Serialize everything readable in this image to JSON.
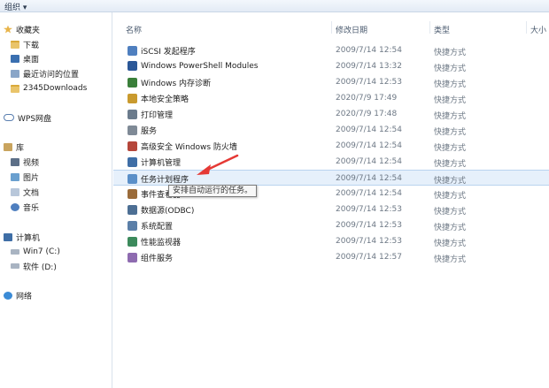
{
  "toolbar": {
    "organize": "组织 ▾"
  },
  "nav": {
    "favorites": "收藏夹",
    "favorite_items": [
      "下载",
      "桌面",
      "最近访问的位置",
      "2345Downloads"
    ],
    "wps": "WPS网盘",
    "library": "库",
    "library_items": [
      "视频",
      "图片",
      "文档",
      "音乐"
    ],
    "computer": "计算机",
    "drives": [
      "Win7 (C:)",
      "软件 (D:)"
    ],
    "network": "网络"
  },
  "columns": {
    "name": "名称",
    "date": "修改日期",
    "type": "类型",
    "size": "大小"
  },
  "files": [
    {
      "name": "iSCSI 发起程序",
      "date": "2009/7/14 12:54",
      "type": "快捷方式",
      "icon": "iscsi-icon",
      "color": "#4f7fbf"
    },
    {
      "name": "Windows PowerShell Modules",
      "date": "2009/7/14 13:32",
      "type": "快捷方式",
      "icon": "powershell-icon",
      "color": "#2b5797"
    },
    {
      "name": "Windows 内存诊断",
      "date": "2009/7/14 12:53",
      "type": "快捷方式",
      "icon": "memory-diagnostic-icon",
      "color": "#3a7f3a"
    },
    {
      "name": "本地安全策略",
      "date": "2020/7/9 17:49",
      "type": "快捷方式",
      "icon": "security-policy-icon",
      "color": "#c99a2e"
    },
    {
      "name": "打印管理",
      "date": "2020/7/9 17:48",
      "type": "快捷方式",
      "icon": "print-management-icon",
      "color": "#6b7b8c"
    },
    {
      "name": "服务",
      "date": "2009/7/14 12:54",
      "type": "快捷方式",
      "icon": "services-icon",
      "color": "#7f8a96"
    },
    {
      "name": "高级安全 Windows 防火墙",
      "date": "2009/7/14 12:54",
      "type": "快捷方式",
      "icon": "firewall-icon",
      "color": "#b5463a"
    },
    {
      "name": "计算机管理",
      "date": "2009/7/14 12:54",
      "type": "快捷方式",
      "icon": "computer-management-icon",
      "color": "#3f6ea6"
    },
    {
      "name": "任务计划程序",
      "date": "2009/7/14 12:54",
      "type": "快捷方式",
      "icon": "task-scheduler-icon",
      "color": "#5a8fc8"
    },
    {
      "name": "事件查看器",
      "date": "2009/7/14 12:54",
      "type": "快捷方式",
      "icon": "event-viewer-icon",
      "color": "#9a6b3a"
    },
    {
      "name": "数据源(ODBC)",
      "date": "2009/7/14 12:53",
      "type": "快捷方式",
      "icon": "odbc-icon",
      "color": "#4d6f94"
    },
    {
      "name": "系统配置",
      "date": "2009/7/14 12:53",
      "type": "快捷方式",
      "icon": "system-config-icon",
      "color": "#5b7fa8"
    },
    {
      "name": "性能监视器",
      "date": "2009/7/14 12:53",
      "type": "快捷方式",
      "icon": "performance-monitor-icon",
      "color": "#3c8a5c"
    },
    {
      "name": "组件服务",
      "date": "2009/7/14 12:57",
      "type": "快捷方式",
      "icon": "component-services-icon",
      "color": "#8e6bb0"
    }
  ],
  "tooltip": "安排自动运行的任务。",
  "colors": {
    "annotation_arrow": "#e53935",
    "selection": "#e6f0fb"
  }
}
